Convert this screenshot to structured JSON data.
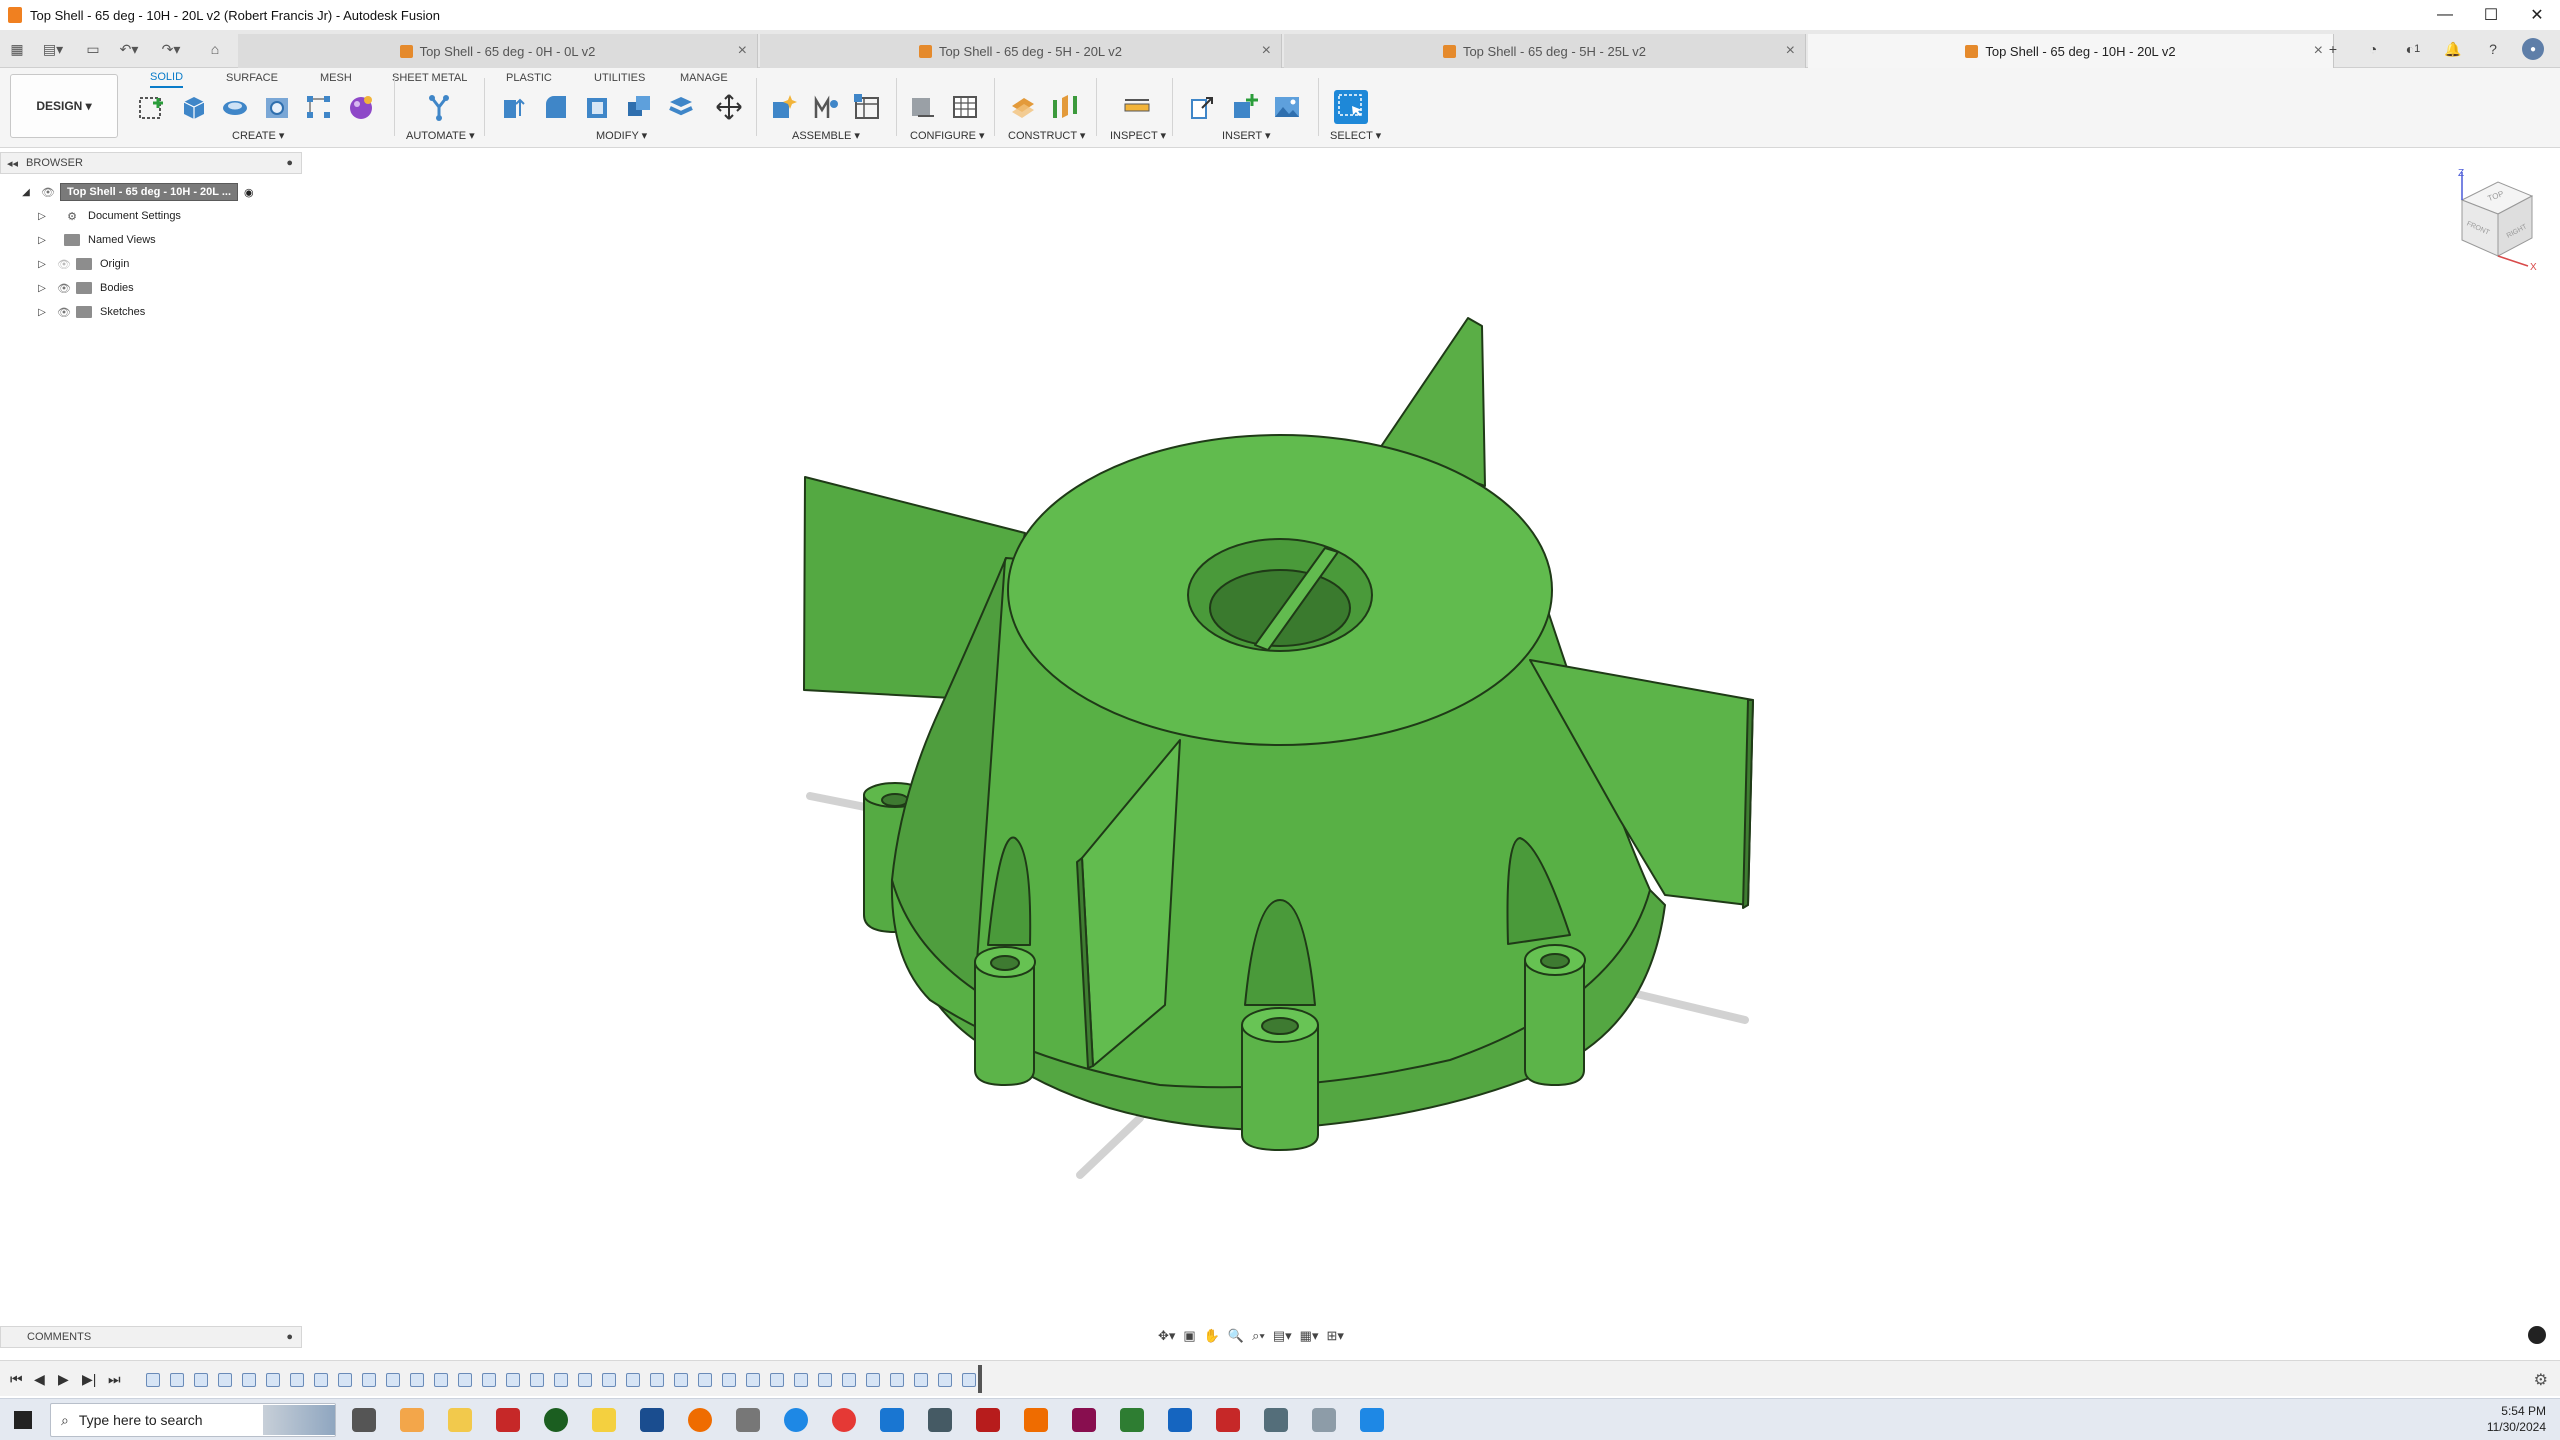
{
  "window": {
    "title": "Top Shell - 65 deg - 10H - 20L v2 (Robert Francis Jr) - Autodesk Fusion",
    "minimize": "—",
    "maximize": "☐",
    "close": "✕"
  },
  "tabs": [
    {
      "label": "Top Shell - 65 deg - 0H - 0L v2",
      "active": false
    },
    {
      "label": "Top Shell - 65 deg - 5H - 20L v2",
      "active": false
    },
    {
      "label": "Top Shell - 65 deg - 5H - 25L v2",
      "active": false
    },
    {
      "label": "Top Shell - 65 deg - 10H - 20L v2",
      "active": true
    }
  ],
  "tab_close": "×",
  "header_right": {
    "jobs_count": "1"
  },
  "toolbar": {
    "workspace": "DESIGN",
    "ribbon_tabs": [
      {
        "label": "SOLID",
        "active": true
      },
      {
        "label": "SURFACE"
      },
      {
        "label": "MESH"
      },
      {
        "label": "SHEET METAL"
      },
      {
        "label": "PLASTIC"
      },
      {
        "label": "UTILITIES"
      },
      {
        "label": "MANAGE"
      }
    ],
    "groups": [
      "CREATE",
      "AUTOMATE",
      "MODIFY",
      "ASSEMBLE",
      "CONFIGURE",
      "CONSTRUCT",
      "INSPECT",
      "INSERT",
      "SELECT"
    ]
  },
  "browser": {
    "header": "BROWSER",
    "root": "Top Shell - 65 deg - 10H - 20L ...",
    "items": [
      {
        "label": "Document Settings",
        "icon": "gear-icon"
      },
      {
        "label": "Named Views",
        "icon": "folder-icon"
      },
      {
        "label": "Origin",
        "icon": "folder-icon"
      },
      {
        "label": "Bodies",
        "icon": "folder-icon"
      },
      {
        "label": "Sketches",
        "icon": "folder-icon"
      }
    ]
  },
  "viewcube": {
    "top": "TOP",
    "front": "FRONT",
    "right": "RIGHT",
    "z": "Z",
    "x": "X"
  },
  "comments": {
    "header": "COMMENTS"
  },
  "taskbar": {
    "search_placeholder": "Type here to search",
    "time": "5:54 PM",
    "date": "11/30/2024"
  },
  "colors": {
    "model_green": "#5cb849",
    "model_edge": "#1f3a17",
    "accent_blue": "#0a7cc9",
    "tab_orange": "#e58a2c"
  }
}
